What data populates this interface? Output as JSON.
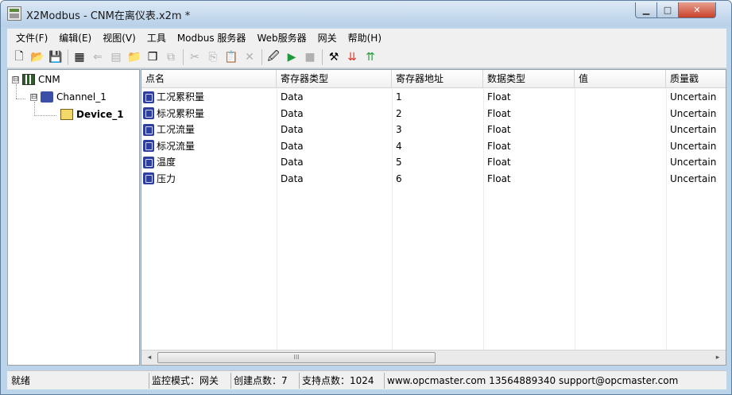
{
  "window": {
    "title": "X2Modbus - CNM在离仪表.x2m *",
    "min_glyph": "▁",
    "max_glyph": "□",
    "close_glyph": "✕"
  },
  "menu": [
    "文件(F)",
    "编辑(E)",
    "视图(V)",
    "工具",
    "Modbus 服务器",
    "Web服务器",
    "网关",
    "帮助(H)"
  ],
  "toolbar": {
    "buttons": [
      {
        "name": "new-file-icon",
        "glyph": "🗋",
        "enabled": true
      },
      {
        "name": "open-folder-icon",
        "glyph": "📂",
        "enabled": true
      },
      {
        "name": "save-icon",
        "glyph": "💾",
        "enabled": true
      },
      {
        "sep": true
      },
      {
        "name": "add-channel-icon",
        "glyph": "▦",
        "enabled": true
      },
      {
        "name": "add-device-icon",
        "glyph": "⇐",
        "enabled": false
      },
      {
        "name": "add-tag-icon",
        "glyph": "▤",
        "enabled": false
      },
      {
        "name": "import-icon",
        "glyph": "📁",
        "enabled": true
      },
      {
        "name": "export-icon",
        "glyph": "❒",
        "enabled": true
      },
      {
        "name": "properties-icon",
        "glyph": "⧉",
        "enabled": false
      },
      {
        "sep": true
      },
      {
        "name": "cut-icon",
        "glyph": "✂",
        "enabled": false
      },
      {
        "name": "copy-icon",
        "glyph": "⎘",
        "enabled": false
      },
      {
        "name": "paste-icon",
        "glyph": "📋",
        "enabled": false
      },
      {
        "name": "delete-icon",
        "glyph": "✕",
        "enabled": false
      },
      {
        "sep": true
      },
      {
        "name": "monitor-icon",
        "glyph": "🖉",
        "enabled": true
      },
      {
        "name": "run-icon",
        "glyph": "▶",
        "enabled": true,
        "color": "#1f9a3a"
      },
      {
        "name": "stop-icon",
        "glyph": "■",
        "enabled": false
      },
      {
        "sep": true
      },
      {
        "name": "tools-icon",
        "glyph": "⚒",
        "enabled": true
      },
      {
        "name": "down-arrows-icon",
        "glyph": "⇊",
        "enabled": true,
        "color": "#d93a2a"
      },
      {
        "name": "up-arrows-icon",
        "glyph": "⇈",
        "enabled": true,
        "color": "#2a9a3a"
      }
    ]
  },
  "tree": {
    "root": {
      "label": "CNM",
      "expander": "⊟"
    },
    "channel": {
      "label": "Channel_1",
      "expander": "⊟"
    },
    "device": {
      "label": "Device_1"
    }
  },
  "grid": {
    "columns": [
      "点名",
      "寄存器类型",
      "寄存器地址",
      "数据类型",
      "值",
      "质量戳"
    ],
    "rows": [
      {
        "name": "工况累积量",
        "reg_type": "Data",
        "address": "1",
        "data_type": "Float",
        "value": "",
        "quality": "Uncertain"
      },
      {
        "name": "标况累积量",
        "reg_type": "Data",
        "address": "2",
        "data_type": "Float",
        "value": "",
        "quality": "Uncertain"
      },
      {
        "name": "工况流量",
        "reg_type": "Data",
        "address": "3",
        "data_type": "Float",
        "value": "",
        "quality": "Uncertain"
      },
      {
        "name": "标况流量",
        "reg_type": "Data",
        "address": "4",
        "data_type": "Float",
        "value": "",
        "quality": "Uncertain"
      },
      {
        "name": "温度",
        "reg_type": "Data",
        "address": "5",
        "data_type": "Float",
        "value": "",
        "quality": "Uncertain"
      },
      {
        "name": "压力",
        "reg_type": "Data",
        "address": "6",
        "data_type": "Float",
        "value": "",
        "quality": "Uncertain"
      }
    ],
    "scroll_left": "◂",
    "scroll_right": "▸",
    "scroll_grip": "III"
  },
  "status": {
    "ready": "就绪",
    "mode": "监控模式：网关",
    "created": "创建点数：7",
    "supported": "支持点数：1024",
    "contact": "www.opcmaster.com 13564889340 support@opcmaster.com"
  }
}
